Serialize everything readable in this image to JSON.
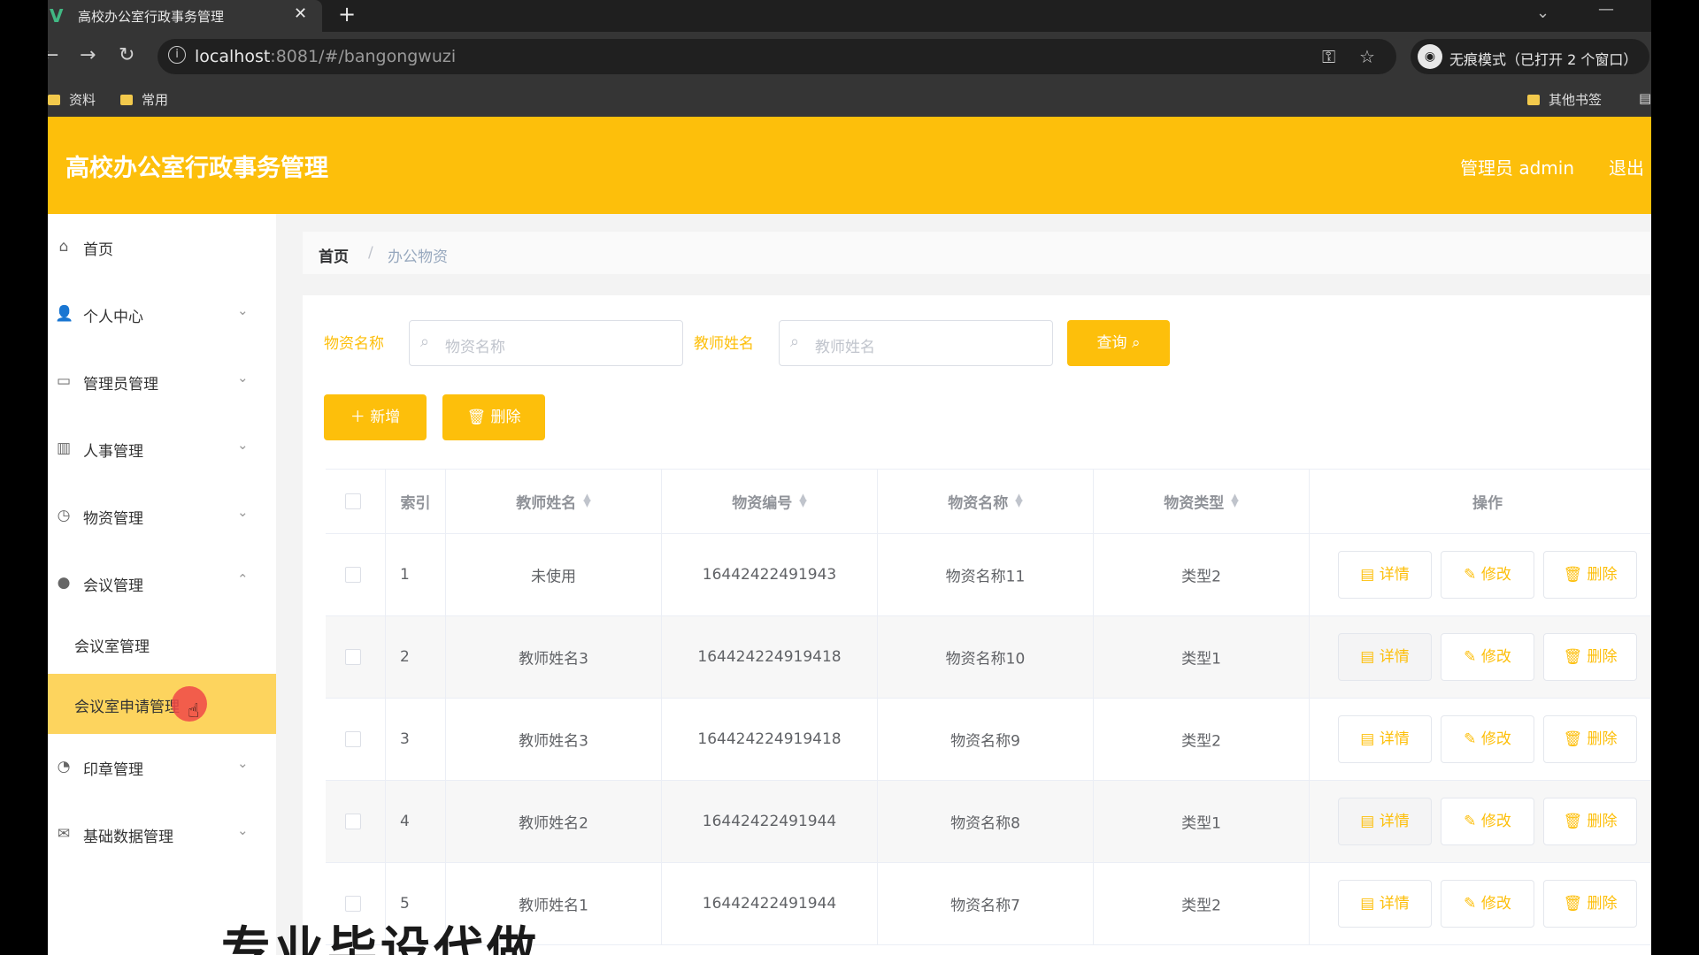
{
  "browser": {
    "tab_title": "高校办公室行政事务管理",
    "tab_close": "✕",
    "tab_new": "+",
    "url_host": "localhost",
    "url_rest": ":8081/#/bangongwuzi",
    "incognito_label": "无痕模式（已打开 2 个窗口）",
    "bookmarks": [
      "资料",
      "常用"
    ],
    "other_bookmarks": "其他书签"
  },
  "header": {
    "title": "高校办公室行政事务管理",
    "user": "管理员 admin",
    "logout": "退出"
  },
  "sidebar": {
    "items": [
      {
        "label": "首页",
        "icon": "home-icon"
      },
      {
        "label": "个人中心",
        "icon": "user-icon"
      },
      {
        "label": "管理员管理",
        "icon": "id-card-icon"
      },
      {
        "label": "人事管理",
        "icon": "books-icon"
      },
      {
        "label": "物资管理",
        "icon": "compass-icon"
      },
      {
        "label": "会议管理",
        "icon": "location-icon"
      },
      {
        "label": "印章管理",
        "icon": "clock-icon"
      },
      {
        "label": "基础数据管理",
        "icon": "mail-icon"
      }
    ],
    "sub_items": [
      "会议室管理",
      "会议室申请管理"
    ]
  },
  "breadcrumb": {
    "home": "首页",
    "sep": "/",
    "current": "办公物资"
  },
  "search": {
    "label1": "物资名称",
    "placeholder1": "物资名称",
    "label2": "教师姓名",
    "placeholder2": "教师姓名",
    "query_btn": "查询"
  },
  "toolbar": {
    "add": "新增",
    "delete": "删除"
  },
  "table": {
    "columns": [
      "索引",
      "教师姓名",
      "物资编号",
      "物资名称",
      "物资类型",
      "操作"
    ],
    "rows": [
      {
        "idx": "1",
        "teacher": "未使用",
        "code": "16442422491943",
        "name": "物资名称11",
        "type": "类型2"
      },
      {
        "idx": "2",
        "teacher": "教师姓名3",
        "code": "164424224919418",
        "name": "物资名称10",
        "type": "类型1"
      },
      {
        "idx": "3",
        "teacher": "教师姓名3",
        "code": "164424224919418",
        "name": "物资名称9",
        "type": "类型2"
      },
      {
        "idx": "4",
        "teacher": "教师姓名2",
        "code": "16442422491944",
        "name": "物资名称8",
        "type": "类型1"
      },
      {
        "idx": "5",
        "teacher": "教师姓名1",
        "code": "16442422491944",
        "name": "物资名称7",
        "type": "类型2"
      }
    ],
    "actions": {
      "detail": "详情",
      "edit": "修改",
      "delete": "删除"
    }
  },
  "overlay_text": "专业毕设代做",
  "colors": {
    "accent": "#fdbf0b",
    "active_menu": "#fdd45e"
  }
}
